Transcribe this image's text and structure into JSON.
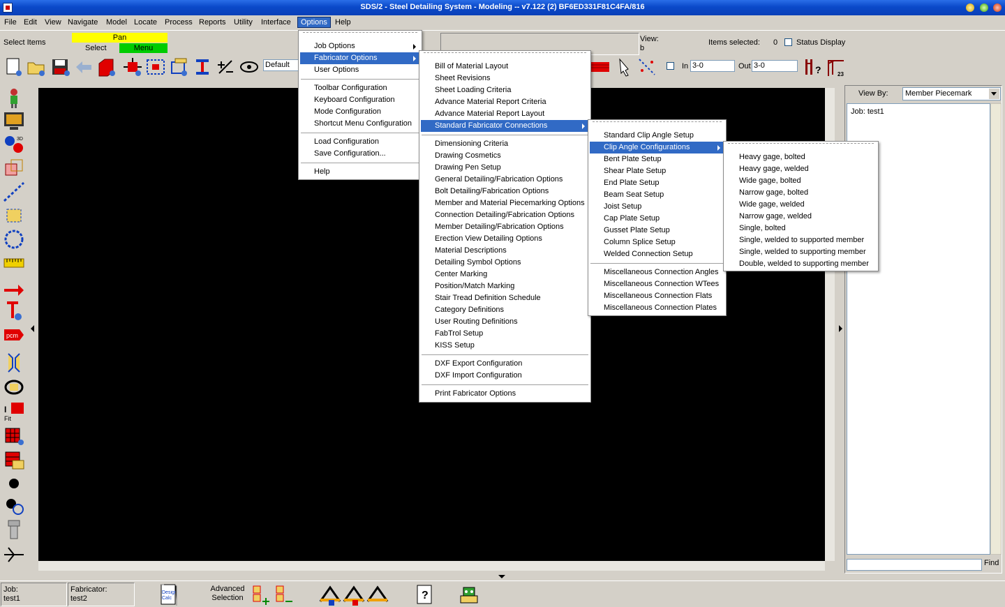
{
  "window": {
    "title": "SDS/2 - Steel Detailing System - Modeling  --  v7.122  (2) BF6ED331F81C4FA/816"
  },
  "menubar": [
    "File",
    "Edit",
    "View",
    "Navigate",
    "Model",
    "Locate",
    "Process",
    "Reports",
    "Utility",
    "Interface",
    "Options",
    "Help"
  ],
  "toolbar": {
    "select_items": "Select Items",
    "pan": "Pan",
    "select": "Select",
    "menu": "Menu",
    "view_mode": "Default",
    "view_label": "View:",
    "view_value": "b",
    "items_selected_label": "Items selected:",
    "items_selected_count": "0",
    "status_display": "Status Display",
    "in_label": "In",
    "in_value": "3-0",
    "out_label": "Out",
    "out_value": "3-0"
  },
  "options_menu": [
    {
      "label": "Job Options",
      "submenu": true
    },
    {
      "label": "Fabricator Options",
      "submenu": true,
      "highlighted": true
    },
    {
      "label": "User Options"
    },
    {
      "sep": true
    },
    {
      "label": "Toolbar Configuration"
    },
    {
      "label": "Keyboard Configuration"
    },
    {
      "label": "Mode Configuration"
    },
    {
      "label": "Shortcut Menu Configuration"
    },
    {
      "sep": true
    },
    {
      "label": "Load Configuration"
    },
    {
      "label": "Save Configuration..."
    },
    {
      "sep": true
    },
    {
      "label": "Help"
    }
  ],
  "fabricator_menu": [
    {
      "label": "Bill of Material Layout"
    },
    {
      "label": "Sheet Revisions"
    },
    {
      "label": "Sheet Loading Criteria"
    },
    {
      "label": "Advance Material Report Criteria"
    },
    {
      "label": "Advance Material Report Layout"
    },
    {
      "label": "Standard Fabricator Connections",
      "submenu": true,
      "highlighted": true
    },
    {
      "sep": true
    },
    {
      "label": "Dimensioning Criteria"
    },
    {
      "label": "Drawing Cosmetics"
    },
    {
      "label": "Drawing Pen Setup"
    },
    {
      "label": "General Detailing/Fabrication Options"
    },
    {
      "label": "Bolt Detailing/Fabrication Options"
    },
    {
      "label": "Member and Material Piecemarking Options"
    },
    {
      "label": "Connection Detailing/Fabrication Options"
    },
    {
      "label": "Member Detailing/Fabrication Options"
    },
    {
      "label": "Erection View Detailing Options"
    },
    {
      "label": "Material Descriptions"
    },
    {
      "label": "Detailing Symbol Options"
    },
    {
      "label": "Center Marking"
    },
    {
      "label": "Position/Match Marking"
    },
    {
      "label": "Stair Tread Definition Schedule"
    },
    {
      "label": "Category Definitions"
    },
    {
      "label": "User Routing Definitions"
    },
    {
      "label": "FabTrol Setup"
    },
    {
      "label": "KISS Setup"
    },
    {
      "sep": true
    },
    {
      "label": "DXF Export Configuration"
    },
    {
      "label": "DXF Import Configuration"
    },
    {
      "sep": true
    },
    {
      "label": "Print Fabricator Options"
    }
  ],
  "connections_menu": [
    {
      "label": "Standard Clip Angle Setup"
    },
    {
      "label": "Clip Angle Configurations",
      "submenu": true,
      "highlighted": true
    },
    {
      "label": "Bent Plate Setup"
    },
    {
      "label": "Shear Plate Setup"
    },
    {
      "label": "End Plate Setup"
    },
    {
      "label": "Beam Seat Setup"
    },
    {
      "label": "Joist Setup"
    },
    {
      "label": "Cap Plate Setup"
    },
    {
      "label": "Gusset Plate Setup"
    },
    {
      "label": "Column Splice Setup"
    },
    {
      "label": "Welded Connection Setup"
    },
    {
      "sep": true
    },
    {
      "label": "Miscellaneous Connection Angles"
    },
    {
      "label": "Miscellaneous Connection WTees"
    },
    {
      "label": "Miscellaneous Connection Flats"
    },
    {
      "label": "Miscellaneous Connection Plates"
    }
  ],
  "clip_menu": [
    {
      "label": "Heavy gage, bolted"
    },
    {
      "label": "Heavy gage, welded"
    },
    {
      "label": "Wide gage, bolted"
    },
    {
      "label": "Narrow gage, bolted"
    },
    {
      "label": "Wide gage, welded"
    },
    {
      "label": "Narrow gage, welded"
    },
    {
      "label": "Single, bolted"
    },
    {
      "label": "Single, welded to supported member"
    },
    {
      "label": "Single, welded to supporting member"
    },
    {
      "label": "Double, welded to supporting member"
    }
  ],
  "right_panel": {
    "view_by_label": "View By:",
    "view_by_value": "Member Piecemark",
    "tree_item": "Job: test1",
    "find_label": "Find"
  },
  "statusbar": {
    "job_label": "Job:",
    "job_value": "test1",
    "fab_label": "Fabricator:",
    "fab_value": "test2",
    "design_calc": "Design Calc",
    "advanced_selection": "Advanced Selection"
  },
  "colors": {
    "accent": "#316ac5",
    "pan": "#ffff00",
    "menu": "#00cc00",
    "canvas": "#000000"
  }
}
